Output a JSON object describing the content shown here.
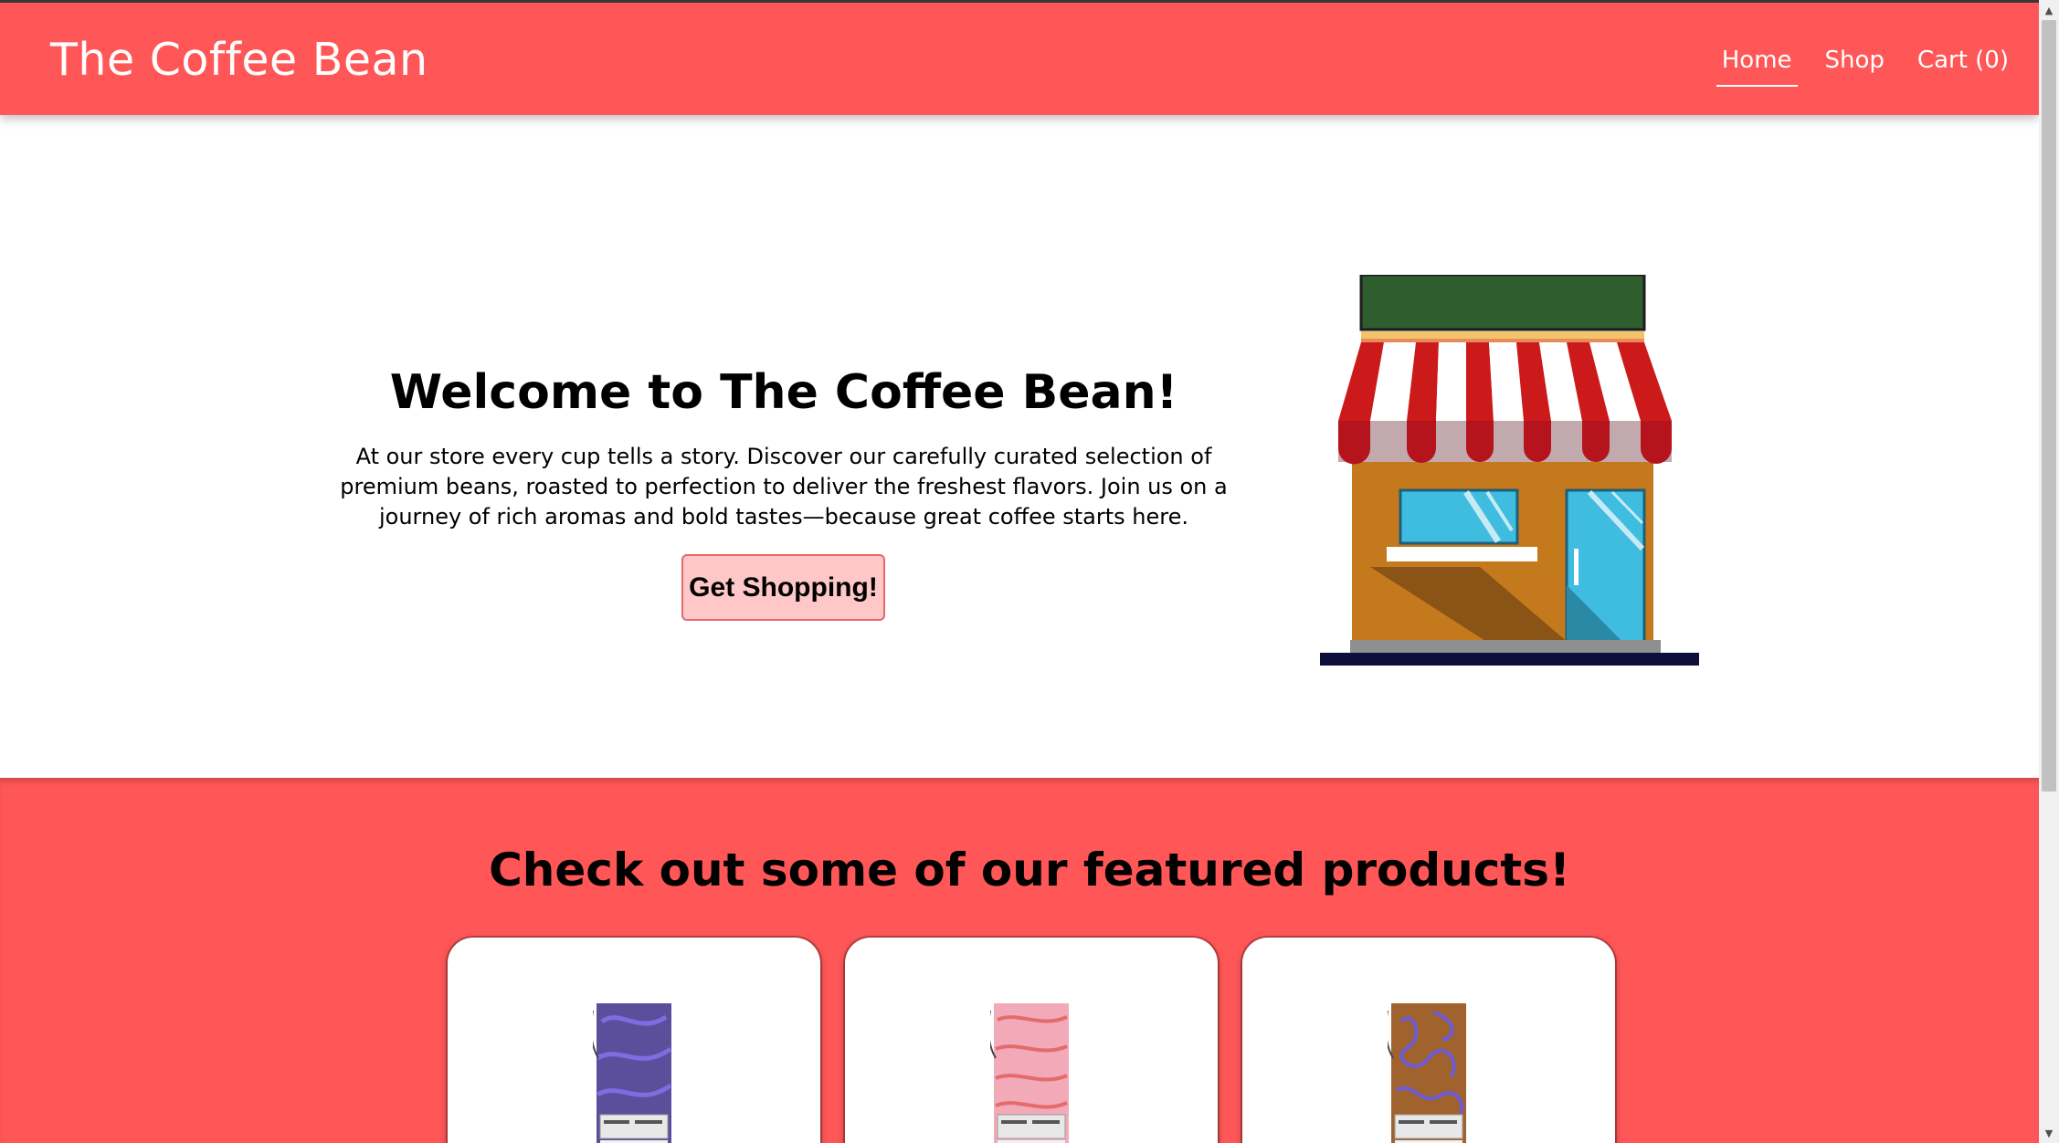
{
  "header": {
    "brand": "The Coffee Bean",
    "nav": [
      {
        "label": "Home",
        "active": true
      },
      {
        "label": "Shop",
        "active": false
      },
      {
        "label": "Cart (0)",
        "active": false
      }
    ]
  },
  "hero": {
    "title": "Welcome to The Coffee Bean!",
    "description": "At our store every cup tells a story. Discover our carefully curated selection of premium beans, roasted to perfection to deliver the freshest flavors. Join us on a journey of rich aromas and bold tastes—because great coffee starts here.",
    "cta_label": "Get Shopping!",
    "image": "storefront-illustration"
  },
  "featured": {
    "title": "Check out some of our featured products!",
    "products": [
      {
        "image": "coffee-bag-purple",
        "color": "#5b4f9c"
      },
      {
        "image": "coffee-bag-pink",
        "color": "#f2a9b8"
      },
      {
        "image": "coffee-bag-brown",
        "color": "#a0632e"
      }
    ]
  },
  "colors": {
    "brand": "#ff5757",
    "button_bg": "#ffc7c7",
    "store_wall": "#c47a1c",
    "store_sign": "#2e5e2e",
    "awning_red": "#cc1a1a",
    "window_blue": "#3ebde0"
  }
}
